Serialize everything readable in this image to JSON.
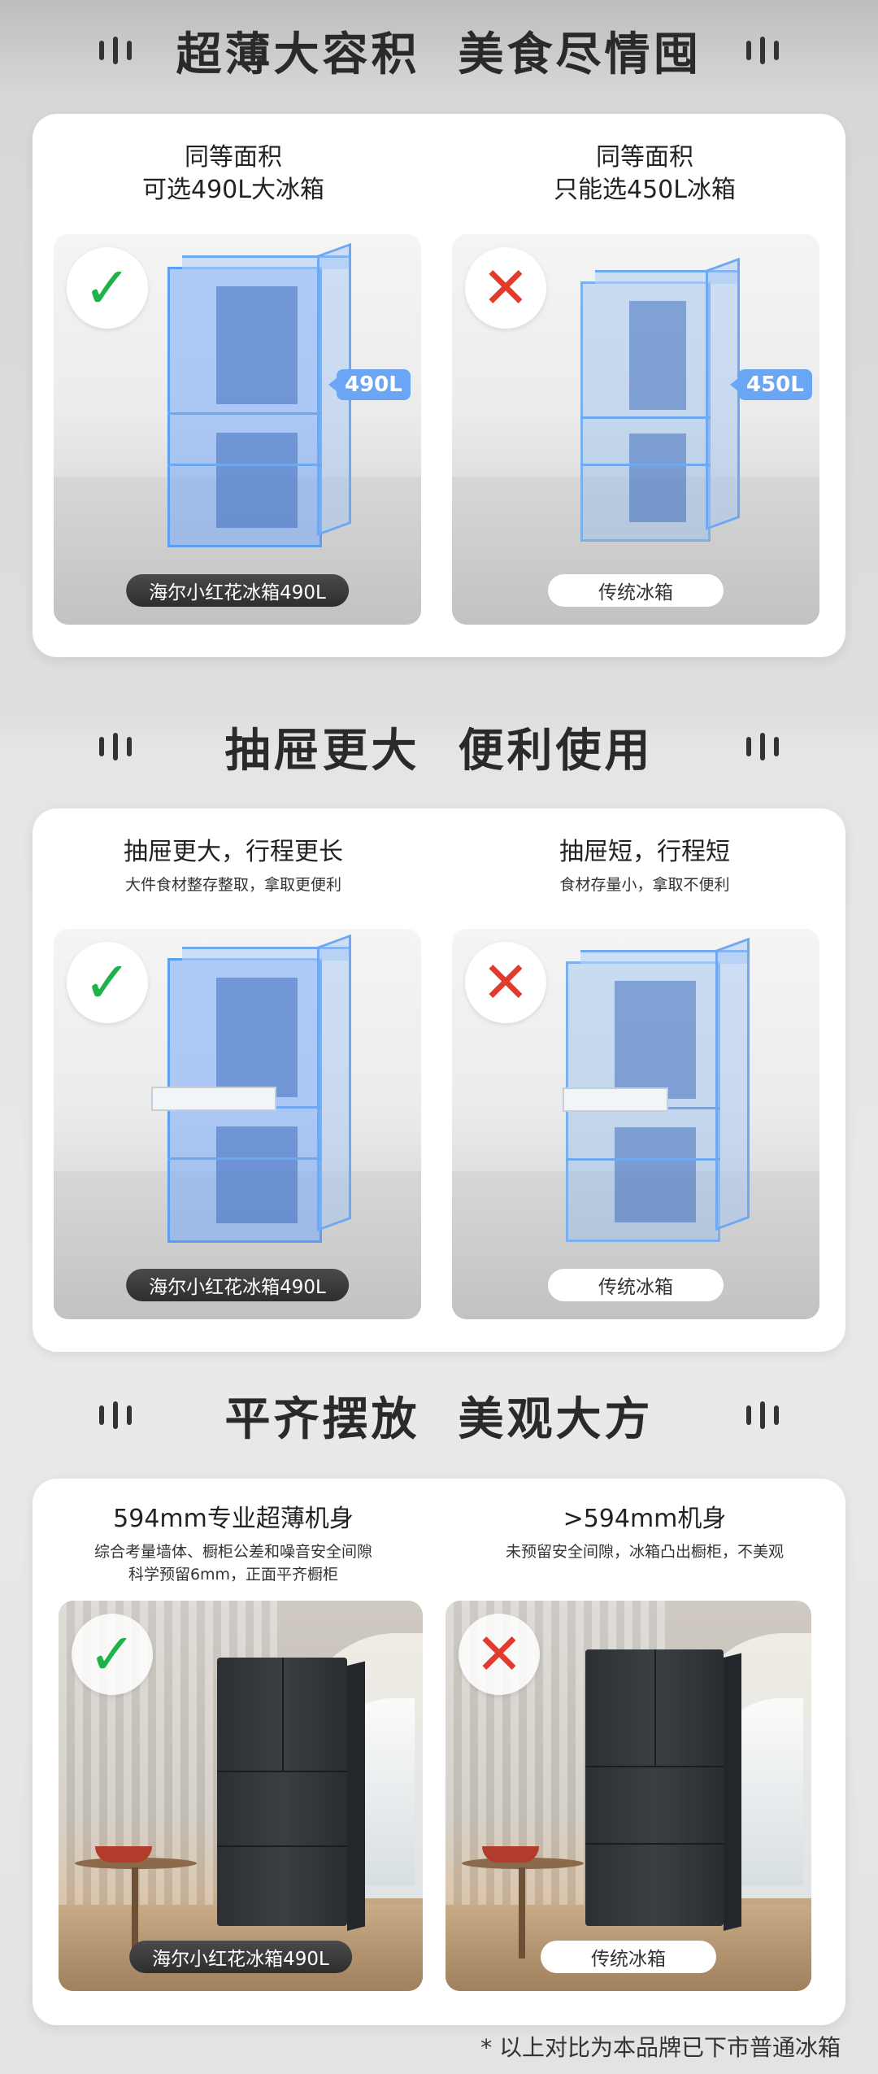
{
  "sections": [
    {
      "title": "超薄大容积  美食尽情囤",
      "left": {
        "heading": "同等面积\n可选490L大冰箱",
        "sub": "",
        "capacity": "490L",
        "label": "海尔小红花冰箱490L",
        "mark": "check"
      },
      "right": {
        "heading": "同等面积\n只能选450L冰箱",
        "sub": "",
        "capacity": "450L",
        "label": "传统冰箱",
        "mark": "cross"
      }
    },
    {
      "title": "抽屉更大  便利使用",
      "left": {
        "heading": "抽屉更大，行程更长",
        "sub": "大件食材整存整取，拿取更便利",
        "label": "海尔小红花冰箱490L",
        "mark": "check"
      },
      "right": {
        "heading": "抽屉短，行程短",
        "sub": "食材存量小，拿取不便利",
        "label": "传统冰箱",
        "mark": "cross"
      }
    },
    {
      "title": "平齐摆放  美观大方",
      "left": {
        "heading": "594mm专业超薄机身",
        "sub": "综合考量墙体、橱柜公差和噪音安全间隙\n科学预留6mm，正面平齐橱柜",
        "label": "海尔小红花冰箱490L",
        "mark": "check"
      },
      "right": {
        "heading": ">594mm机身",
        "sub": "未预留安全间隙，冰箱凸出橱柜，不美观",
        "label": "传统冰箱",
        "mark": "cross"
      }
    }
  ],
  "marks": {
    "check": "✓",
    "cross": "✕"
  },
  "footnote": "* 以上对比为本品牌已下市普通冰箱",
  "colors": {
    "check": "#20b24a",
    "cross": "#e23b2e",
    "capacity_tag": "#6aa6f4"
  }
}
